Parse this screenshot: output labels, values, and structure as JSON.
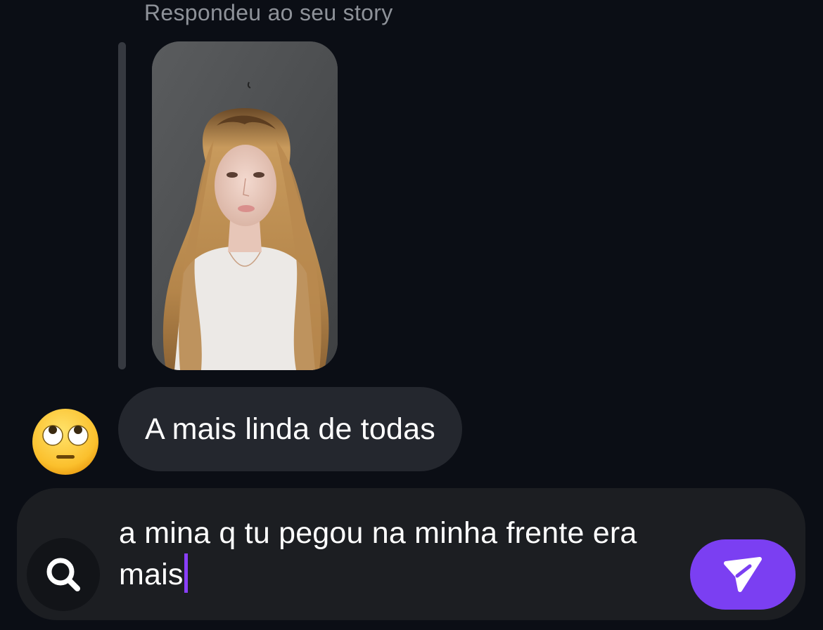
{
  "reply": {
    "caption": "Respondeu ao seu story"
  },
  "reaction": {
    "emoji": "🙄",
    "icon": "face-with-rolling-eyes-icon"
  },
  "message": {
    "text": "A mais linda de todas"
  },
  "composer": {
    "input_value": "a mina q tu pegou na minha frente era mais",
    "search_icon": "search-icon",
    "send_icon": "send-paper-plane-icon",
    "send_color": "#7b3ff2",
    "caret_color": "#8a3ffc"
  },
  "colors": {
    "background": "#0b0e15",
    "bubble": "#24272e",
    "composer": "#1c1e22"
  }
}
